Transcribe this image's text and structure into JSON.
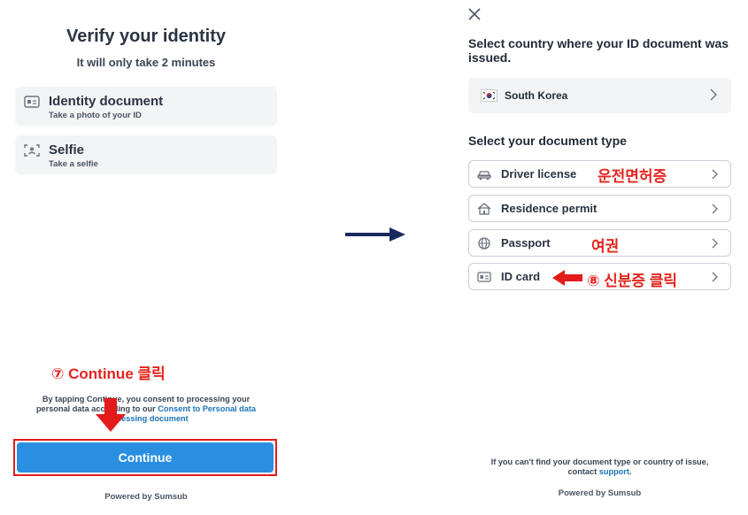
{
  "left": {
    "title": "Verify your identity",
    "subtitle": "It will only take 2 minutes",
    "options": [
      {
        "title": "Identity document",
        "subtitle": "Take a photo of your ID",
        "icon": "id-card-icon"
      },
      {
        "title": "Selfie",
        "subtitle": "Take a selfie",
        "icon": "face-scan-icon"
      }
    ],
    "annotation": "⑦ Continue 클릭",
    "consent": {
      "line1": "By tapping Continue, you consent to processing your",
      "line2_prefix": "personal data according to our ",
      "line2_link": "Consent to Personal data",
      "line3_link": "processing document"
    },
    "continue_label": "Continue",
    "powered_by": "Powered by Sumsub"
  },
  "right": {
    "heading": "Select country where your ID document was issued.",
    "country": {
      "name": "South Korea",
      "flag": "south-korea-flag"
    },
    "doc_heading": "Select your document type",
    "documents": [
      {
        "label": "Driver license",
        "icon": "car-icon",
        "note": "운전면허증"
      },
      {
        "label": "Residence permit",
        "icon": "house-icon",
        "note": ""
      },
      {
        "label": "Passport",
        "icon": "globe-icon",
        "note": "여권"
      },
      {
        "label": "ID card",
        "icon": "id-card-icon",
        "note": "⑧ 신분증 클릭"
      }
    ],
    "footer": {
      "line1": "If you can't find your document type or country of issue,",
      "line2_prefix": "contact ",
      "link": "support",
      "line2_suffix": "."
    },
    "powered_by": "Powered by Sumsub"
  },
  "colors": {
    "accent": "#2a8fe0",
    "annotation": "#e3251e",
    "link": "#1a73b8",
    "arrow": "#1b2a5e"
  }
}
